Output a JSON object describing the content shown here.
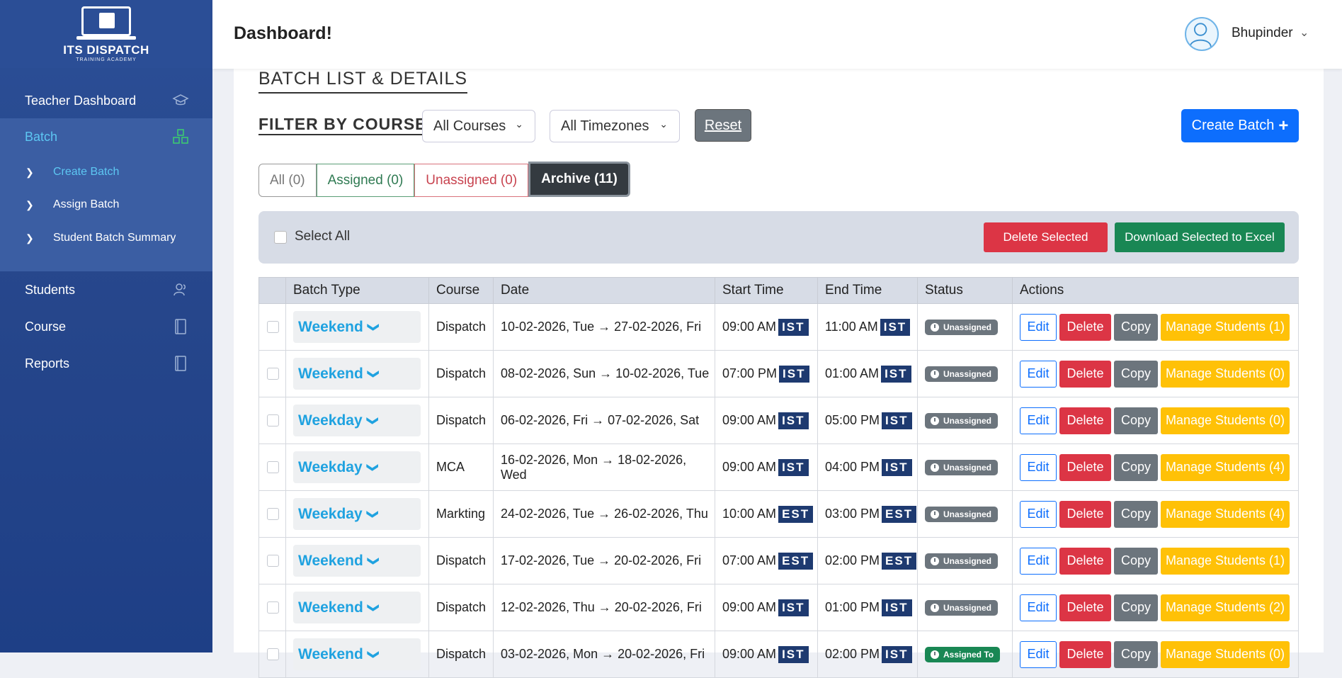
{
  "brand": {
    "title": "ITS DISPATCH",
    "subtitle": "TRAINING ACADEMY"
  },
  "sidebar": {
    "items": [
      {
        "label": "Teacher Dashboard",
        "icon": "graduation-cap-icon"
      },
      {
        "label": "Batch",
        "icon": "blocks-icon"
      },
      {
        "label": "Students",
        "icon": "users-icon"
      },
      {
        "label": "Course",
        "icon": "book-icon"
      },
      {
        "label": "Reports",
        "icon": "book-icon"
      }
    ],
    "subitems": [
      {
        "label": "Create Batch"
      },
      {
        "label": "Assign Batch"
      },
      {
        "label": "Student Batch Summary"
      }
    ]
  },
  "header": {
    "title": "Dashboard!",
    "user": "Bhupinder"
  },
  "main": {
    "section_title": "BATCH LIST & DETAILS",
    "filter_label": "FILTER BY COURSE:",
    "course_select": "All Courses",
    "timezone_select": "All Timezones",
    "reset": "Reset",
    "create_batch": "Create Batch",
    "tabs": [
      "All (0)",
      "Assigned (0)",
      "Unassigned (0)",
      "Archive (11)"
    ],
    "select_all": "Select All",
    "delete_selected": "Delete Selected",
    "download_selected": "Download Selected to Excel"
  },
  "table": {
    "headers": [
      "Batch Type",
      "Course",
      "Date",
      "Start Time",
      "End Time",
      "Status",
      "Actions"
    ],
    "actions": {
      "edit": "Edit",
      "delete": "Delete",
      "copy": "Copy"
    },
    "rows": [
      {
        "type": "Weekend",
        "course": "Dispatch",
        "date": "10-02-2026, Tue → 27-02-2026, Fri",
        "start": "09:00 AM",
        "start_tz": "IST",
        "end": "11:00 AM",
        "end_tz": "IST",
        "status": "Unassigned",
        "manage": "Manage Students (1)"
      },
      {
        "type": "Weekend",
        "course": "Dispatch",
        "date": "08-02-2026, Sun → 10-02-2026, Tue",
        "start": "07:00 PM",
        "start_tz": "IST",
        "end": "01:00 AM",
        "end_tz": "IST",
        "status": "Unassigned",
        "manage": "Manage Students (0)"
      },
      {
        "type": "Weekday",
        "course": "Dispatch",
        "date": "06-02-2026, Fri → 07-02-2026, Sat",
        "start": "09:00 AM",
        "start_tz": "IST",
        "end": "05:00 PM",
        "end_tz": "IST",
        "status": "Unassigned",
        "manage": "Manage Students (0)"
      },
      {
        "type": "Weekday",
        "course": "MCA",
        "date": "16-02-2026, Mon → 18-02-2026, Wed",
        "start": "09:00 AM",
        "start_tz": "IST",
        "end": "04:00 PM",
        "end_tz": "IST",
        "status": "Unassigned",
        "manage": "Manage Students (4)"
      },
      {
        "type": "Weekday",
        "course": "Markting",
        "date": "24-02-2026, Tue → 26-02-2026, Thu",
        "start": "10:00 AM",
        "start_tz": "EST",
        "end": "03:00 PM",
        "end_tz": "EST",
        "status": "Unassigned",
        "manage": "Manage Students (4)"
      },
      {
        "type": "Weekend",
        "course": "Dispatch",
        "date": "17-02-2026, Tue → 20-02-2026, Fri",
        "start": "07:00 AM",
        "start_tz": "EST",
        "end": "02:00 PM",
        "end_tz": "EST",
        "status": "Unassigned",
        "manage": "Manage Students (1)"
      },
      {
        "type": "Weekend",
        "course": "Dispatch",
        "date": "12-02-2026, Thu → 20-02-2026, Fri",
        "start": "09:00 AM",
        "start_tz": "IST",
        "end": "01:00 PM",
        "end_tz": "IST",
        "status": "Unassigned",
        "manage": "Manage Students (2)"
      },
      {
        "type": "Weekend",
        "course": "Dispatch",
        "date": "03-02-2026, Mon → 20-02-2026, Fri",
        "start": "09:00 AM",
        "start_tz": "IST",
        "end": "02:00 PM",
        "end_tz": "IST",
        "status": "Assigned To",
        "manage": "Manage Students (0)"
      }
    ]
  },
  "colors": {
    "primary": "#0d6efd",
    "danger": "#dc3545",
    "success": "#198754",
    "warning": "#ffc107",
    "secondary": "#6c757d",
    "sidebar": "#27478c",
    "accent": "#1fa2e0"
  }
}
